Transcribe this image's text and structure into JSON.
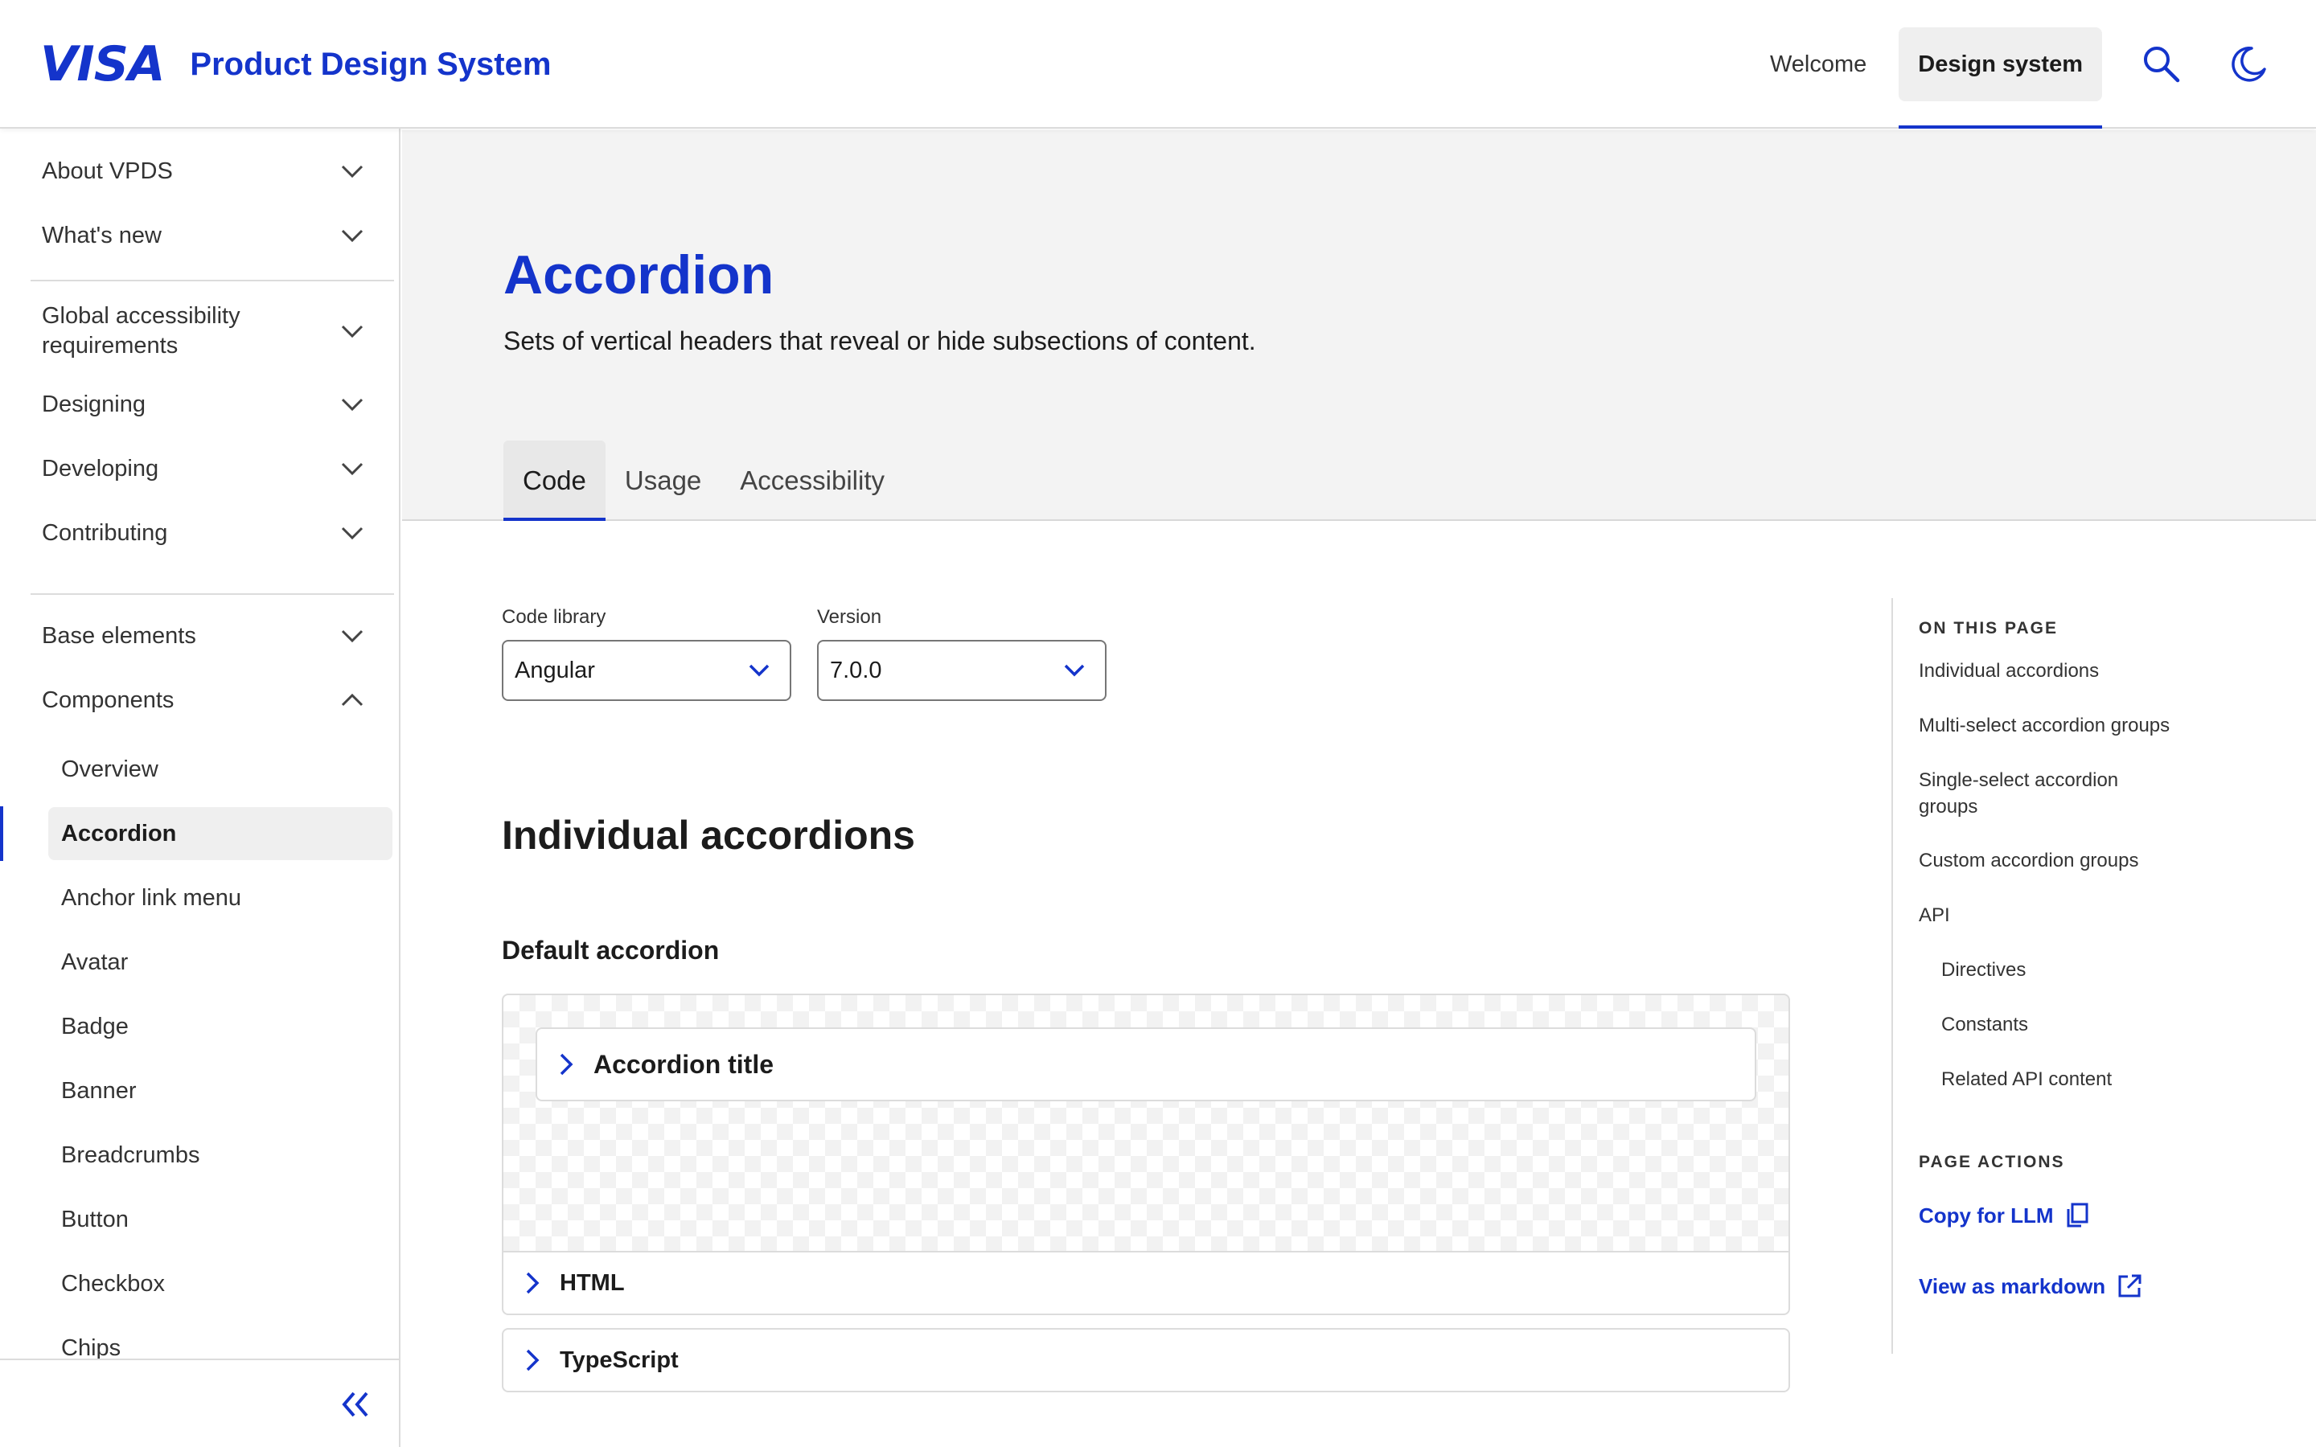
{
  "header": {
    "logo": "VISA",
    "title": "Product Design System",
    "nav": {
      "welcome": "Welcome",
      "design_system": "Design system"
    },
    "icons": {
      "search": "search-icon",
      "theme": "moon-icon"
    }
  },
  "sidebar": {
    "group1": [
      "About VPDS",
      "What's new"
    ],
    "group2": [
      "Global accessibility requirements",
      "Designing",
      "Developing",
      "Contributing"
    ],
    "group3": [
      "Base elements",
      "Components"
    ],
    "components": [
      "Overview",
      "Accordion",
      "Anchor link menu",
      "Avatar",
      "Badge",
      "Banner",
      "Breadcrumbs",
      "Button",
      "Checkbox",
      "Chips"
    ],
    "active_item": "Accordion"
  },
  "hero": {
    "title": "Accordion",
    "description": "Sets of vertical headers that reveal or hide subsections of content.",
    "tabs": [
      "Code",
      "Usage",
      "Accessibility"
    ],
    "active_tab": "Code"
  },
  "main": {
    "code_library": {
      "label": "Code library",
      "value": "Angular"
    },
    "version": {
      "label": "Version",
      "value": "7.0.0"
    },
    "section_title": "Individual accordions",
    "subsection_title": "Default accordion",
    "demo_accordion_title": "Accordion title",
    "code_panels": [
      "HTML",
      "TypeScript"
    ]
  },
  "rail": {
    "on_this_page": "ON THIS PAGE",
    "links": [
      "Individual accordions",
      "Multi-select accordion groups",
      "Single-select accordion groups",
      "Custom accordion groups",
      "API"
    ],
    "nested_links": [
      "Directives",
      "Constants",
      "Related API content"
    ],
    "page_actions": "PAGE ACTIONS",
    "copy_for_llm": "Copy for LLM",
    "view_as_markdown": "View as markdown"
  },
  "colors": {
    "brand": "#1434cb",
    "text": "#1c1c1c",
    "hero_bg": "#f3f3f3",
    "border": "#dcdcdc"
  }
}
